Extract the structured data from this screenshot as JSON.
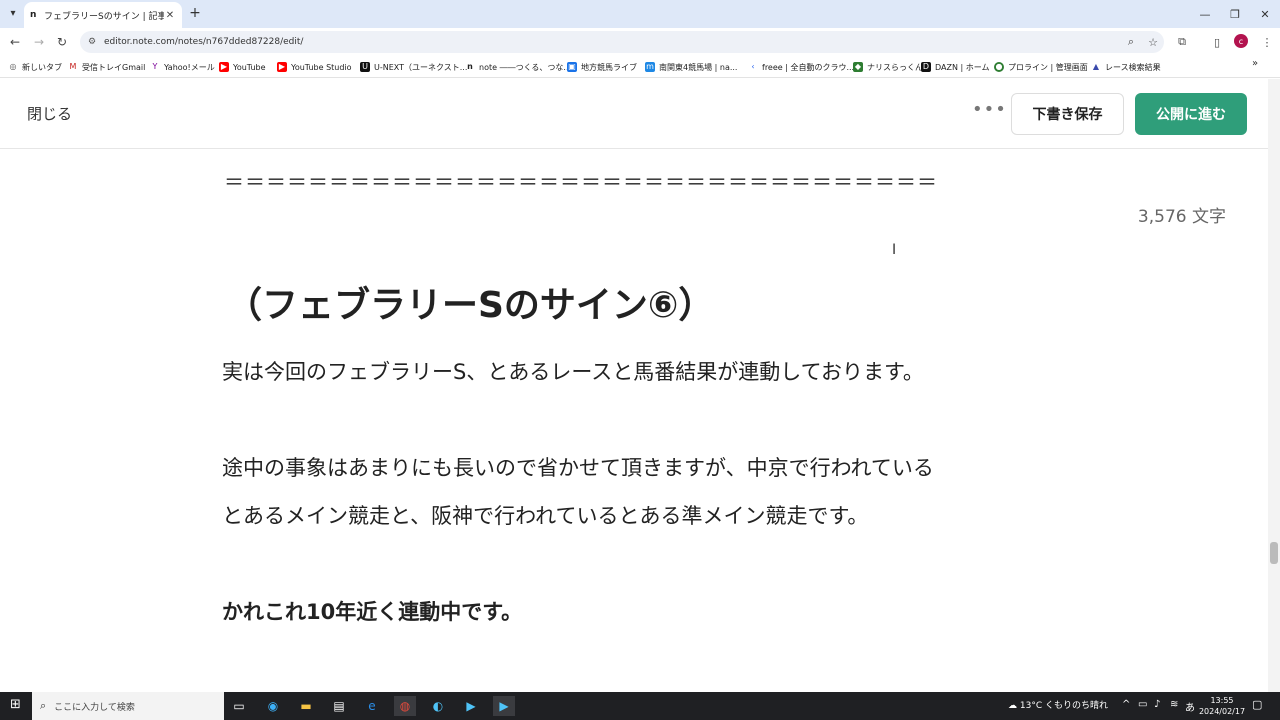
{
  "browser": {
    "tab": {
      "favicon": "n",
      "title": "フェブラリーSのサイン | 記事編集 | n",
      "close": "✕"
    },
    "new_tab": "+",
    "window": {
      "minimize": "—",
      "maximize": "❐",
      "close": "✕"
    },
    "url": "editor.note.com/notes/n767dded87228/edit/",
    "bookmarks": [
      {
        "label": "新しいタブ",
        "icon": "globe-icon",
        "color": "#555555"
      },
      {
        "label": "受信トレイGmail",
        "icon": "gmail-icon",
        "color": "#c5221f"
      },
      {
        "label": "Yahoo!メール",
        "icon": "yahoo-icon",
        "color": "#7b0099"
      },
      {
        "label": "YouTube",
        "icon": "youtube-icon",
        "color": "#ff0000"
      },
      {
        "label": "YouTube Studio",
        "icon": "youtube-studio-icon",
        "color": "#ff0000"
      },
      {
        "label": "U-NEXT（ユーネクスト...",
        "icon": "unext-icon",
        "color": "#111111"
      },
      {
        "label": "note ――つくる、つな...",
        "icon": "note-icon",
        "color": "#222222"
      },
      {
        "label": "地方競馬ライブ",
        "icon": "keiba-live-icon",
        "color": "#1a73e8"
      },
      {
        "label": "南関東4競馬場 | na...",
        "icon": "nankan-icon",
        "color": "#1e88e5"
      },
      {
        "label": "freee | 全自動のクラウ...",
        "icon": "freee-icon",
        "color": "#2864f0"
      },
      {
        "label": "ナリスらっくん",
        "icon": "nari-icon",
        "color": "#2e7d32"
      },
      {
        "label": "DAZN | ホーム",
        "icon": "dazn-icon",
        "color": "#111111"
      },
      {
        "label": "プロライン | 管理画面",
        "icon": "proline-icon",
        "color": "#2e7d32"
      },
      {
        "label": "レース検索結果",
        "icon": "race-icon",
        "color": "#3949ab"
      }
    ],
    "bookmarks_more": "»"
  },
  "editor": {
    "close_label": "閉じる",
    "more_label": "•••",
    "draft_label": "下書き保存",
    "publish_label": "公開に進む",
    "separator": "＝＝＝＝＝＝＝＝＝＝＝＝＝＝＝＝＝＝＝＝＝＝＝＝＝＝＝＝＝＝＝＝＝＝",
    "word_count": "3,576 文字",
    "heading": "（フェブラリーSのサイン⑥）",
    "paragraphs": {
      "p1": "実は今回のフェブラリーS、とあるレースと馬番結果が連動しております。",
      "p2a": "途中の事象はあまりにも長いので省かせて頂きますが、中京で行われている",
      "p2b": "とあるメイン競走と、阪神で行われているとある準メイン競走です。",
      "p3": "かれこれ10年近く連動中です。"
    }
  },
  "taskbar": {
    "search_placeholder": "ここに入力して検索",
    "weather": "13°C くもりのち晴れ",
    "ime": "あ",
    "time": "13:55",
    "date": "2024/02/17"
  }
}
